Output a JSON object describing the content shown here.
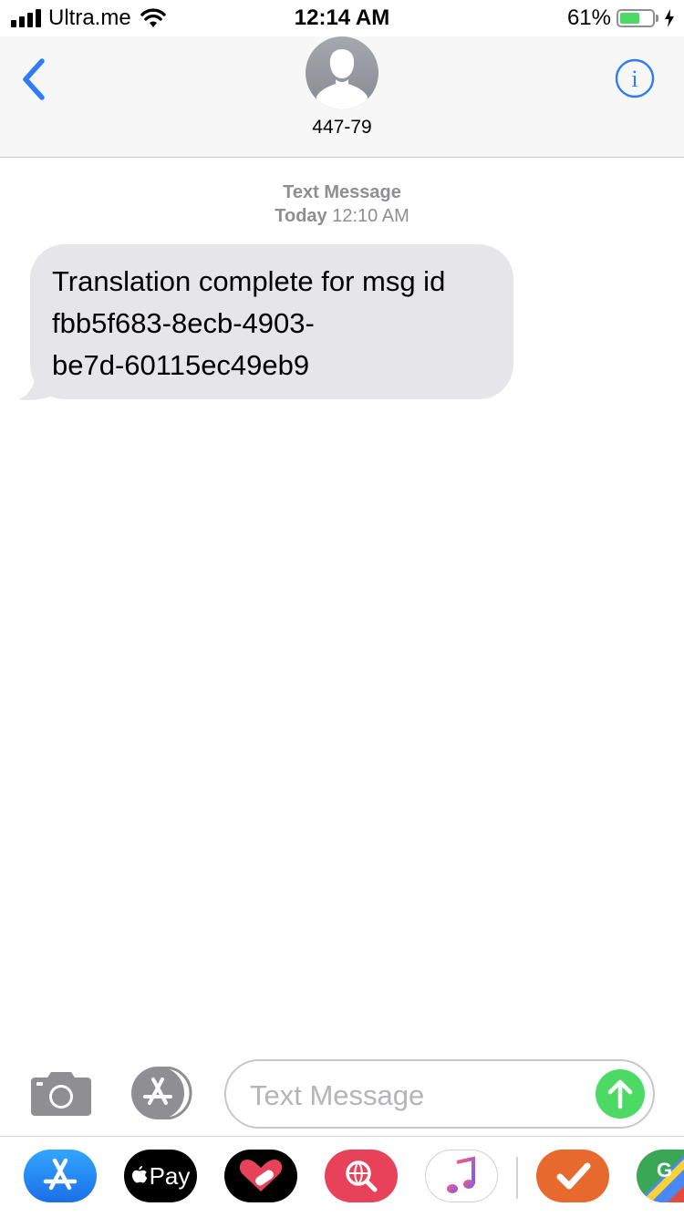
{
  "status_bar": {
    "carrier": "Ultra.me",
    "time": "12:14 AM",
    "battery_percent_label": "61%",
    "battery_level": 0.61
  },
  "header": {
    "contact_name": "447-79"
  },
  "conversation": {
    "service_label": "Text Message",
    "day_label": "Today",
    "time_label": "12:10 AM",
    "messages": [
      {
        "direction": "incoming",
        "text": "Translation complete for msg id\nfbb5f683-8ecb-4903-\nbe7d-60115ec49eb9"
      }
    ]
  },
  "composer": {
    "placeholder": "Text Message",
    "value": ""
  },
  "app_drawer": {
    "apple_pay_label": "Pay",
    "apps": [
      "app-store-icon",
      "apple-pay-icon",
      "heart-app-icon",
      "search-globe-icon",
      "music-icon",
      "checkmark-app-icon",
      "google-maps-icon"
    ]
  },
  "colors": {
    "ios_blue": "#2e7cf6",
    "incoming_bubble": "#e5e5ea",
    "send_green": "#4cd964",
    "meta_gray": "#8e8e93"
  }
}
